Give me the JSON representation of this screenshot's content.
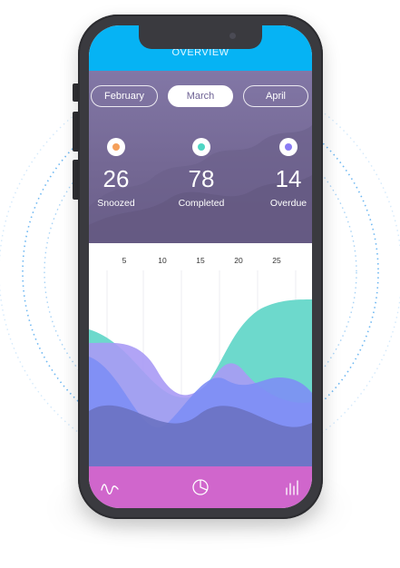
{
  "header": {
    "title": "OVERVIEW"
  },
  "months": [
    {
      "label": "February",
      "active": false
    },
    {
      "label": "March",
      "active": true
    },
    {
      "label": "April",
      "active": false
    }
  ],
  "stats": [
    {
      "value": "26",
      "label": "Snoozed",
      "dot_color": "#f5a05a"
    },
    {
      "value": "78",
      "label": "Completed",
      "dot_color": "#4fd6c4"
    },
    {
      "value": "14",
      "label": "Overdue",
      "dot_color": "#8a7cf4"
    }
  ],
  "chart": {
    "ticks": [
      "5",
      "10",
      "15",
      "20",
      "25"
    ],
    "colors": {
      "teal": "#6dd9cc",
      "lavender": "#a99af5",
      "blue": "#7d8ef5",
      "navy": "#6a72c2"
    }
  },
  "bottom_nav": [
    {
      "icon": "wave-icon"
    },
    {
      "icon": "pie-chart-icon"
    },
    {
      "icon": "bar-chart-icon"
    }
  ],
  "colors": {
    "topbar": "#06b3f4",
    "bottombar": "#d066cc",
    "hero": "#746894"
  }
}
